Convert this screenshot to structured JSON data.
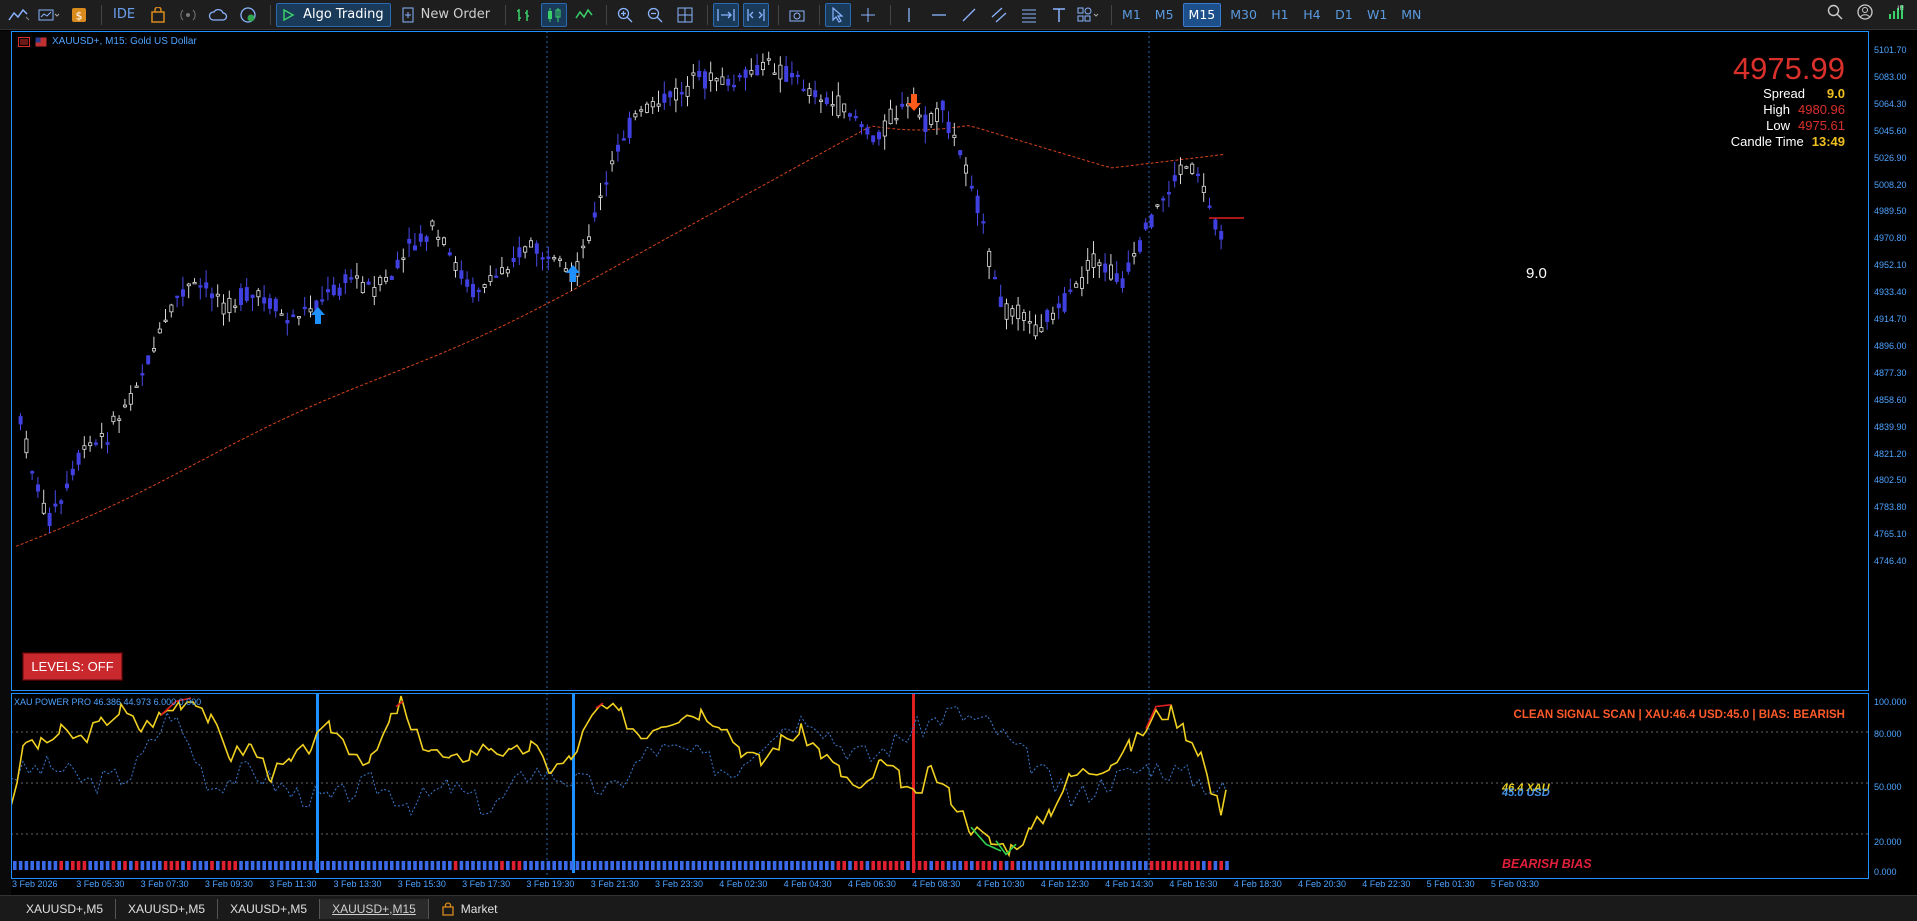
{
  "toolbar": {
    "algo_trading": "Algo Trading",
    "new_order": "New Order",
    "ide": "IDE",
    "timeframes": [
      "M1",
      "M5",
      "M15",
      "M30",
      "H1",
      "H4",
      "D1",
      "W1",
      "MN"
    ],
    "active_timeframe": "M15"
  },
  "chart": {
    "title": "XAUUSD+, M15:  Gold US Dollar",
    "price_axis": [
      "5101.70",
      "5083.00",
      "5064.30",
      "5045.60",
      "5026.90",
      "5008.20",
      "4989.50",
      "4970.80",
      "4952.10",
      "4933.40",
      "4914.70",
      "4896.00",
      "4877.30",
      "4858.60",
      "4839.90",
      "4821.20",
      "4802.50",
      "4783.80",
      "4765.10",
      "4746.40"
    ],
    "spread_line_label": "9.0",
    "levels_button": "LEVELS: OFF"
  },
  "info": {
    "price": "4975.99",
    "spread_label": "Spread",
    "spread_value": "9.0",
    "high_label": "High",
    "high_value": "4980.96",
    "low_label": "Low",
    "low_value": "4975.61",
    "candle_time_label": "Candle Time",
    "candle_time_value": "13:49",
    "colors": {
      "price": "#d9302c",
      "spread": "#f0c020",
      "high": "#d9302c",
      "low": "#d9302c",
      "candle_time": "#f0c020"
    }
  },
  "indicator": {
    "title": "XAU POWER PRO 46.386 44.973 6.000 0.000",
    "scan_text": "CLEAN SIGNAL SCAN | XAU:46.4 USD:45.0 | BIAS: BEARISH",
    "bias_text": "BEARISH BIAS",
    "xau_tag": "46.4 XAU",
    "usd_tag": "45.0 USD",
    "axis": [
      "100.000",
      "80.000",
      "50.000",
      "20.000",
      "0.000"
    ]
  },
  "time_axis": [
    "3 Feb 2026",
    "3 Feb 05:30",
    "3 Feb 07:30",
    "3 Feb 09:30",
    "3 Feb 11:30",
    "3 Feb 13:30",
    "3 Feb 15:30",
    "3 Feb 17:30",
    "3 Feb 19:30",
    "3 Feb 21:30",
    "3 Feb 23:30",
    "4 Feb 02:30",
    "4 Feb 04:30",
    "4 Feb 06:30",
    "4 Feb 08:30",
    "4 Feb 10:30",
    "4 Feb 12:30",
    "4 Feb 14:30",
    "4 Feb 16:30",
    "4 Feb 18:30",
    "4 Feb 20:30",
    "4 Feb 22:30",
    "5 Feb 01:30",
    "5 Feb 03:30"
  ],
  "tabs": [
    "XAUUSD+,M5",
    "XAUUSD+,M5",
    "XAUUSD+,M5",
    "XAUUSD+,M15"
  ],
  "active_tab": 3,
  "market_tab": "Market"
}
